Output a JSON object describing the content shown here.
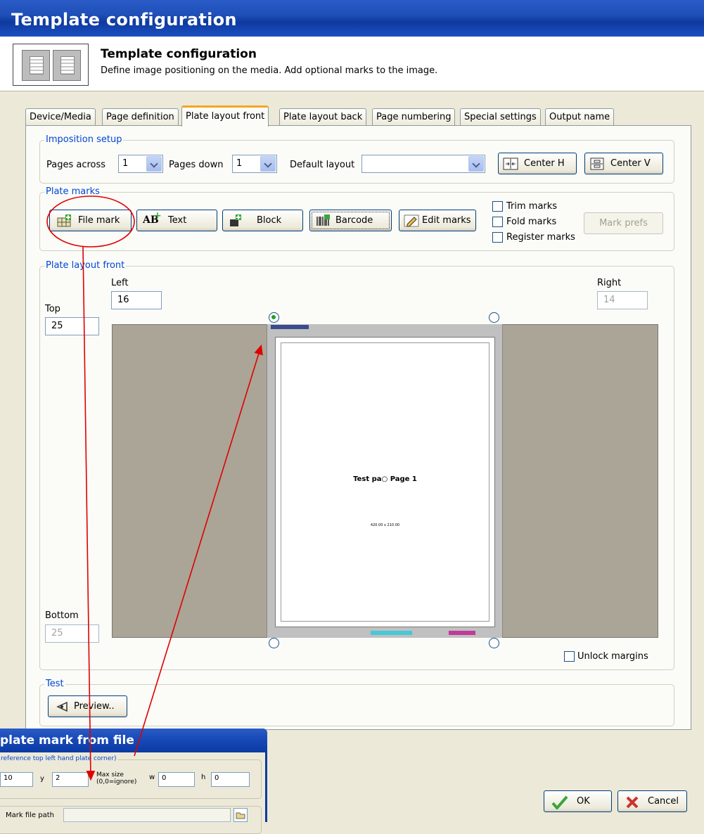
{
  "window": {
    "title": "Template configuration"
  },
  "header": {
    "title": "Template configuration",
    "description": "Define image positioning on the media. Add optional marks to the image."
  },
  "tabs": [
    {
      "label": "Device/Media",
      "active": false
    },
    {
      "label": "Page definition",
      "active": false
    },
    {
      "label": "Plate layout front",
      "active": true
    },
    {
      "label": "Plate layout back",
      "active": false
    },
    {
      "label": "Page numbering",
      "active": false
    },
    {
      "label": "Special settings",
      "active": false
    },
    {
      "label": "Output name",
      "active": false
    }
  ],
  "imposition": {
    "legend": "Imposition setup",
    "pages_across_label": "Pages across",
    "pages_across_value": "1",
    "pages_down_label": "Pages down",
    "pages_down_value": "1",
    "default_layout_label": "Default layout",
    "default_layout_value": "",
    "center_h_label": "Center H",
    "center_v_label": "Center V"
  },
  "plate_marks": {
    "legend": "Plate marks",
    "file_mark_label": "File mark",
    "text_label": "Text",
    "block_label": "Block",
    "barcode_label": "Barcode",
    "edit_marks_label": "Edit marks",
    "trim_marks_label": "Trim marks",
    "trim_marks_checked": false,
    "fold_marks_label": "Fold marks",
    "fold_marks_checked": false,
    "register_marks_label": "Register marks",
    "register_marks_checked": false,
    "mark_prefs_label": "Mark prefs"
  },
  "layout": {
    "legend": "Plate layout front",
    "left_label": "Left",
    "left_value": "16",
    "right_label": "Right",
    "right_value": "14",
    "top_label": "Top",
    "top_value": "25",
    "bottom_label": "Bottom",
    "bottom_value": "25",
    "page_text": "Test pa○ Page 1",
    "page_subtext": "420.00 x 210.00",
    "unlock_margins_label": "Unlock margins",
    "unlock_margins_checked": false
  },
  "test": {
    "legend": "Test",
    "preview_label": "Preview.."
  },
  "footer": {
    "ok_label": "OK",
    "cancel_label": "Cancel"
  },
  "dialog": {
    "title": "plate mark from file",
    "group_legend": "reference top left hand plate corner)",
    "x_value": "10",
    "y_label": "y",
    "y_value": "2",
    "max_size_label": "Max size",
    "max_size_hint": "(0,0=ignore)",
    "w_label": "w",
    "w_value": "0",
    "h_label": "h",
    "h_value": "0",
    "mark_file_path_label": "Mark file path",
    "mark_file_path_value": ""
  },
  "colors": {
    "title_bar": "#1f4fb8",
    "annotation": "#e00000",
    "plate_bg": "#aaa596",
    "cyan_bar": "#46c8d8",
    "magenta_bar": "#c03a9a",
    "tab_active_accent": "#f5a623"
  }
}
